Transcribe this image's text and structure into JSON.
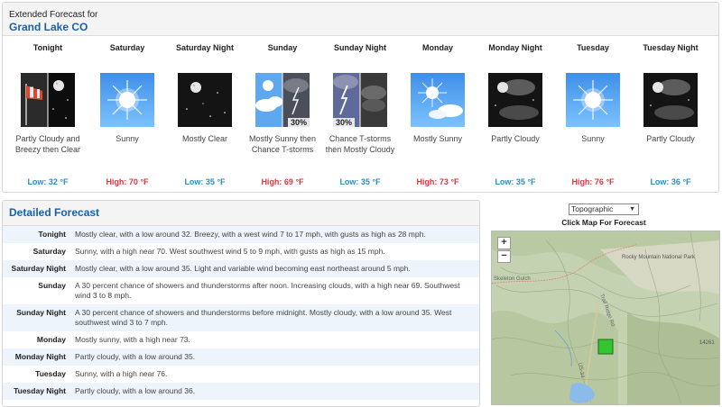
{
  "header": {
    "subtitle": "Extended Forecast for",
    "location": "Grand Lake CO"
  },
  "periods": [
    {
      "name": "Tonight",
      "desc": "Partly Cloudy and Breezy then Clear",
      "temp": "Low: 32 °F",
      "kind": "lo",
      "icon": "night-wind-clear-icon"
    },
    {
      "name": "Saturday",
      "desc": "Sunny",
      "temp": "High: 70 °F",
      "kind": "hi",
      "icon": "sunny-icon"
    },
    {
      "name": "Saturday Night",
      "desc": "Mostly Clear",
      "temp": "Low: 35 °F",
      "kind": "lo",
      "icon": "night-clear-icon"
    },
    {
      "name": "Sunday",
      "desc": "Mostly Sunny then Chance T-storms",
      "temp": "High: 69 °F",
      "kind": "hi",
      "icon": "sunny-tstorm-icon",
      "pop": "30%"
    },
    {
      "name": "Sunday Night",
      "desc": "Chance T-storms then Mostly Cloudy",
      "temp": "Low: 35 °F",
      "kind": "lo",
      "icon": "tstorm-night-icon",
      "pop": "30%"
    },
    {
      "name": "Monday",
      "desc": "Mostly Sunny",
      "temp": "High: 73 °F",
      "kind": "hi",
      "icon": "mostly-sunny-icon"
    },
    {
      "name": "Monday Night",
      "desc": "Partly Cloudy",
      "temp": "Low: 35 °F",
      "kind": "lo",
      "icon": "night-partly-cloudy-icon"
    },
    {
      "name": "Tuesday",
      "desc": "Sunny",
      "temp": "High: 76 °F",
      "kind": "hi",
      "icon": "sunny-icon"
    },
    {
      "name": "Tuesday Night",
      "desc": "Partly Cloudy",
      "temp": "Low: 36 °F",
      "kind": "lo",
      "icon": "night-partly-cloudy-icon"
    }
  ],
  "detailed": {
    "title": "Detailed Forecast",
    "rows": [
      {
        "k": "Tonight",
        "v": "Mostly clear, with a low around 32. Breezy, with a west wind 7 to 17 mph, with gusts as high as 28 mph."
      },
      {
        "k": "Saturday",
        "v": "Sunny, with a high near 70. West southwest wind 5 to 9 mph, with gusts as high as 15 mph."
      },
      {
        "k": "Saturday Night",
        "v": "Mostly clear, with a low around 35. Light and variable wind becoming east northeast around 5 mph."
      },
      {
        "k": "Sunday",
        "v": "A 30 percent chance of showers and thunderstorms after noon. Increasing clouds, with a high near 69. Southwest wind 3 to 8 mph."
      },
      {
        "k": "Sunday Night",
        "v": "A 30 percent chance of showers and thunderstorms before midnight. Mostly cloudy, with a low around 35. West southwest wind 3 to 7 mph."
      },
      {
        "k": "Monday",
        "v": "Mostly sunny, with a high near 73."
      },
      {
        "k": "Monday Night",
        "v": "Partly cloudy, with a low around 35."
      },
      {
        "k": "Tuesday",
        "v": "Sunny, with a high near 76."
      },
      {
        "k": "Tuesday Night",
        "v": "Partly cloudy, with a low around 36."
      }
    ]
  },
  "map": {
    "layer_selected": "Topographic",
    "caption": "Click Map For Forecast",
    "zoom_in": "+",
    "zoom_out": "−",
    "labels": {
      "park": "Rocky Mountain National Park",
      "road": "Trail Ridge Rd",
      "elev": "14261",
      "skeleton": "Skeleton Gulch",
      "hwy": "US-34",
      "lake": "Lake"
    }
  },
  "colors": {
    "link": "#1b5fa6",
    "high": "#d9363e",
    "low": "#2a8ec3",
    "stripe": "#eef4fb"
  }
}
